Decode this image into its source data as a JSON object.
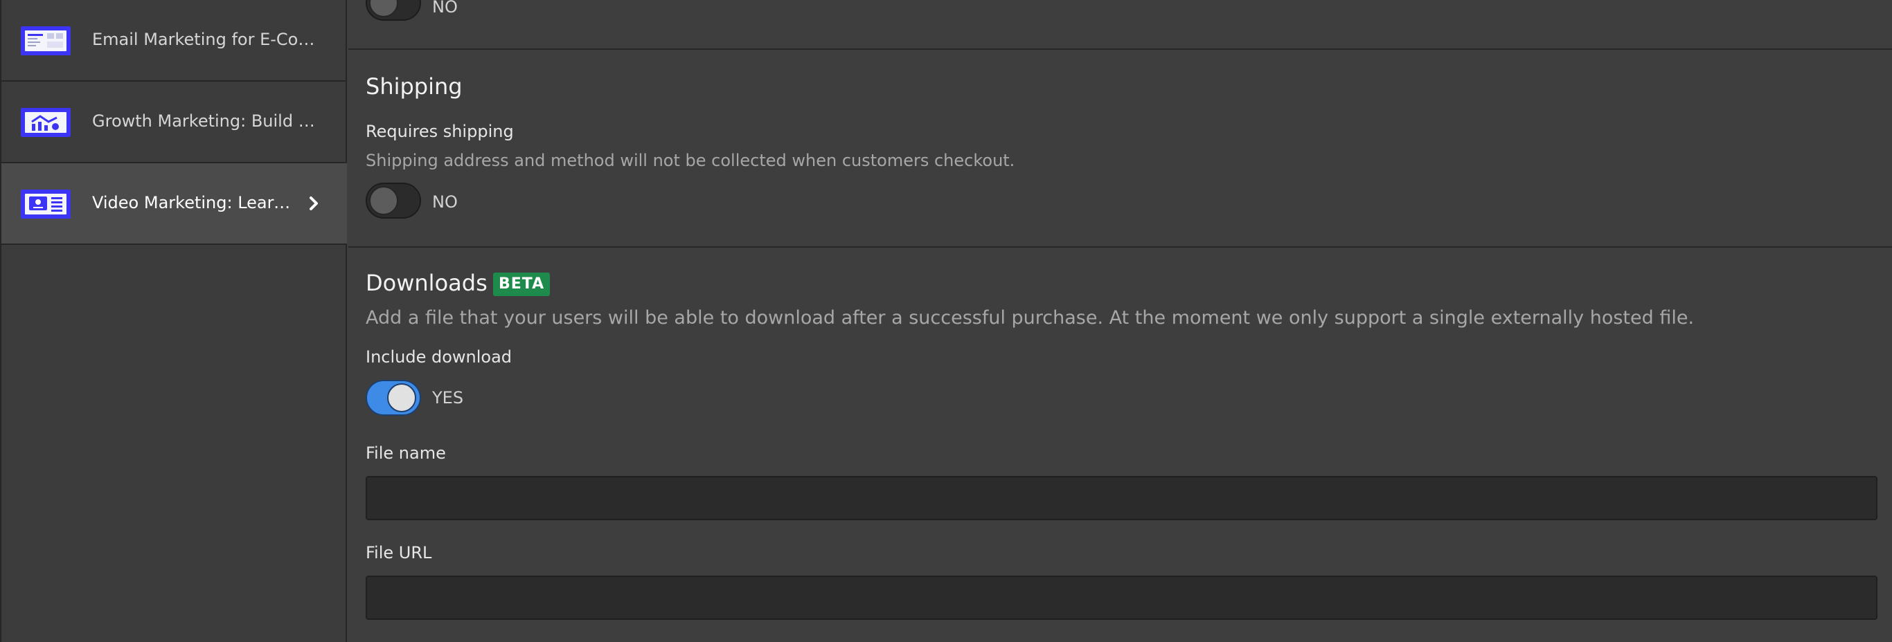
{
  "sidebar": {
    "items": [
      {
        "label": "Email Marketing for E-Com...",
        "icon": "course-thumbnail-icon"
      },
      {
        "label": "Growth Marketing: Build Hi...",
        "icon": "course-thumbnail-icon"
      },
      {
        "label": "Video Marketing: Learn t...",
        "icon": "course-thumbnail-icon",
        "active": true
      }
    ]
  },
  "main": {
    "top_toggle": {
      "state_text": "NO",
      "checked": false
    },
    "shipping": {
      "heading": "Shipping",
      "field_label": "Requires shipping",
      "help": "Shipping address and method will not be collected when customers checkout.",
      "toggle_text": "NO",
      "checked": false
    },
    "downloads": {
      "heading": "Downloads",
      "badge": "BETA",
      "help": "Add a file that your users will be able to download after a successful purchase. At the moment we only support a single externally hosted file.",
      "include_label": "Include download",
      "toggle_text": "YES",
      "checked": true,
      "file_name_label": "File name",
      "file_name_value": "",
      "file_url_label": "File URL",
      "file_url_value": ""
    }
  },
  "colors": {
    "accent": "#3d8be6",
    "badge": "#1e8a4c",
    "thumbnail": "#3d35f5"
  }
}
